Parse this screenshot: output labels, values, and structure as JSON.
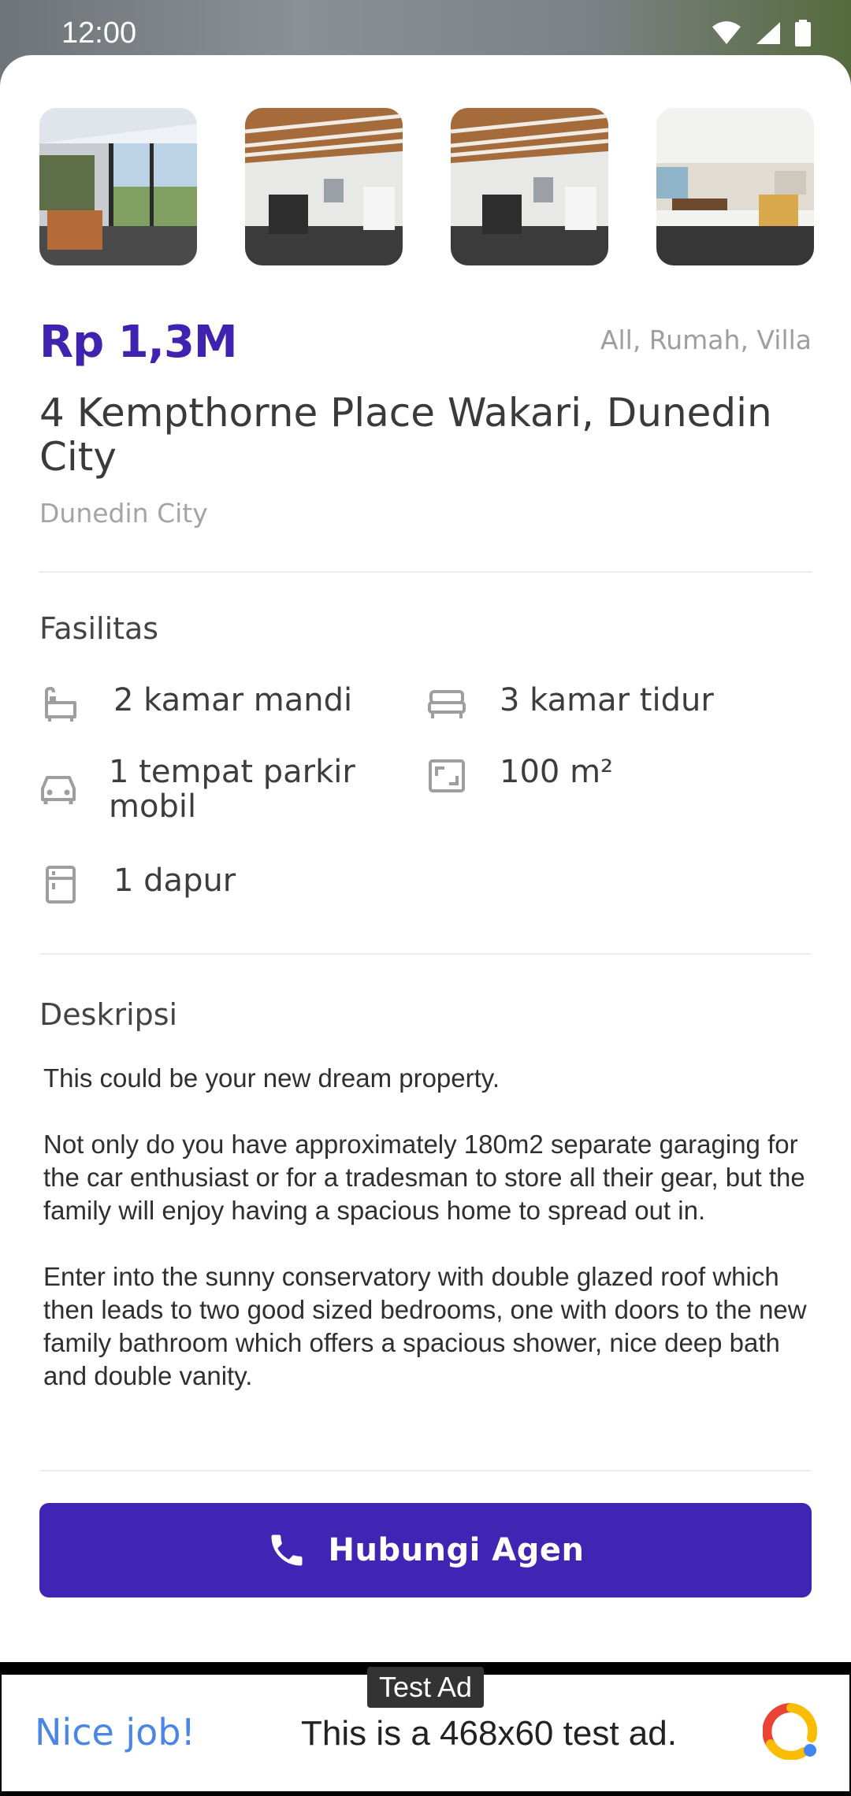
{
  "status_bar": {
    "time": "12:00"
  },
  "gallery": {
    "thumbnails": [
      {
        "alt": "conservatory"
      },
      {
        "alt": "living-room"
      },
      {
        "alt": "living-room-2"
      },
      {
        "alt": "kitchen-dining"
      }
    ]
  },
  "listing": {
    "price": "Rp 1,3M",
    "tags": "All, Rumah, Villa",
    "title": "4 Kempthorne Place Wakari, Dunedin City",
    "city": "Dunedin City"
  },
  "facilities": {
    "heading": "Fasilitas",
    "items": [
      {
        "icon": "bathtub-icon",
        "label": "2 kamar mandi"
      },
      {
        "icon": "bed-icon",
        "label": "3 kamar tidur"
      },
      {
        "icon": "car-icon",
        "label": "1 tempat parkir mobil"
      },
      {
        "icon": "area-icon",
        "label": "100 m²"
      },
      {
        "icon": "kitchen-icon",
        "label": "1 dapur"
      }
    ]
  },
  "description": {
    "heading": "Deskripsi",
    "paragraphs": [
      "This could be your new dream property.",
      "Not only do you have approximately 180m2 separate garaging for the car enthusiast or for a tradesman to store all their gear, but the family will enjoy having a spacious home to spread out in.",
      "Enter into the sunny conservatory with double glazed roof which then leads to two good sized bedrooms, one with doors to the new family bathroom which offers a spacious shower, nice deep bath and double vanity."
    ]
  },
  "cta": {
    "label": "Hubungi Agen",
    "icon": "phone-icon"
  },
  "ad": {
    "tag": "Test Ad",
    "headline": "Nice job!",
    "text": "This is a 468x60 test ad."
  },
  "colors": {
    "primary": "#4024b4",
    "price": "#3f22b0",
    "muted": "#9e9e9e",
    "ad_link": "#4a86e8"
  }
}
